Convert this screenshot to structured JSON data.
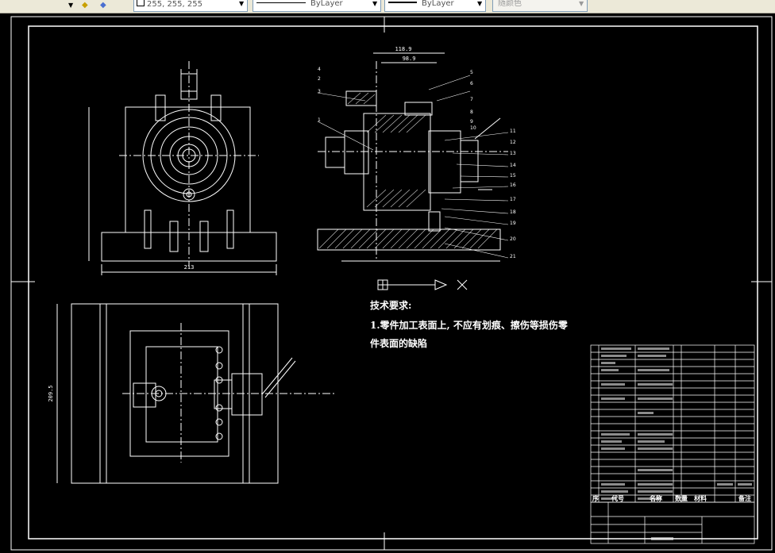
{
  "toolbar": {
    "color_value": "255, 255, 255",
    "linetype_value": "ByLayer",
    "lineweight_value": "ByLayer",
    "plotstyle_value": "随颜色"
  },
  "drawing": {
    "tech_heading": "技术要求:",
    "tech_line1": "1.零件加工表面上, 不应有划痕、擦伤等损伤零",
    "tech_line2": "件表面的缺陷",
    "dim_top_a": "118.9",
    "dim_top_b": "98.9",
    "dim_front_width": "213",
    "dim_left_height": "209.5",
    "table_header": {
      "col_seq": "序",
      "col_code": "代号",
      "col_name": "名称",
      "col_qty": "数量",
      "col_material": "材料",
      "col_note": "备注"
    },
    "balloons": [
      "1",
      "2",
      "3",
      "4",
      "5",
      "6",
      "7",
      "8",
      "9",
      "10",
      "11",
      "12",
      "13",
      "14",
      "15",
      "16",
      "17",
      "18",
      "19",
      "20",
      "21"
    ]
  },
  "colors": {
    "background": "#000000",
    "lines": "#ffffff",
    "toolbar": "#ece9d8"
  }
}
